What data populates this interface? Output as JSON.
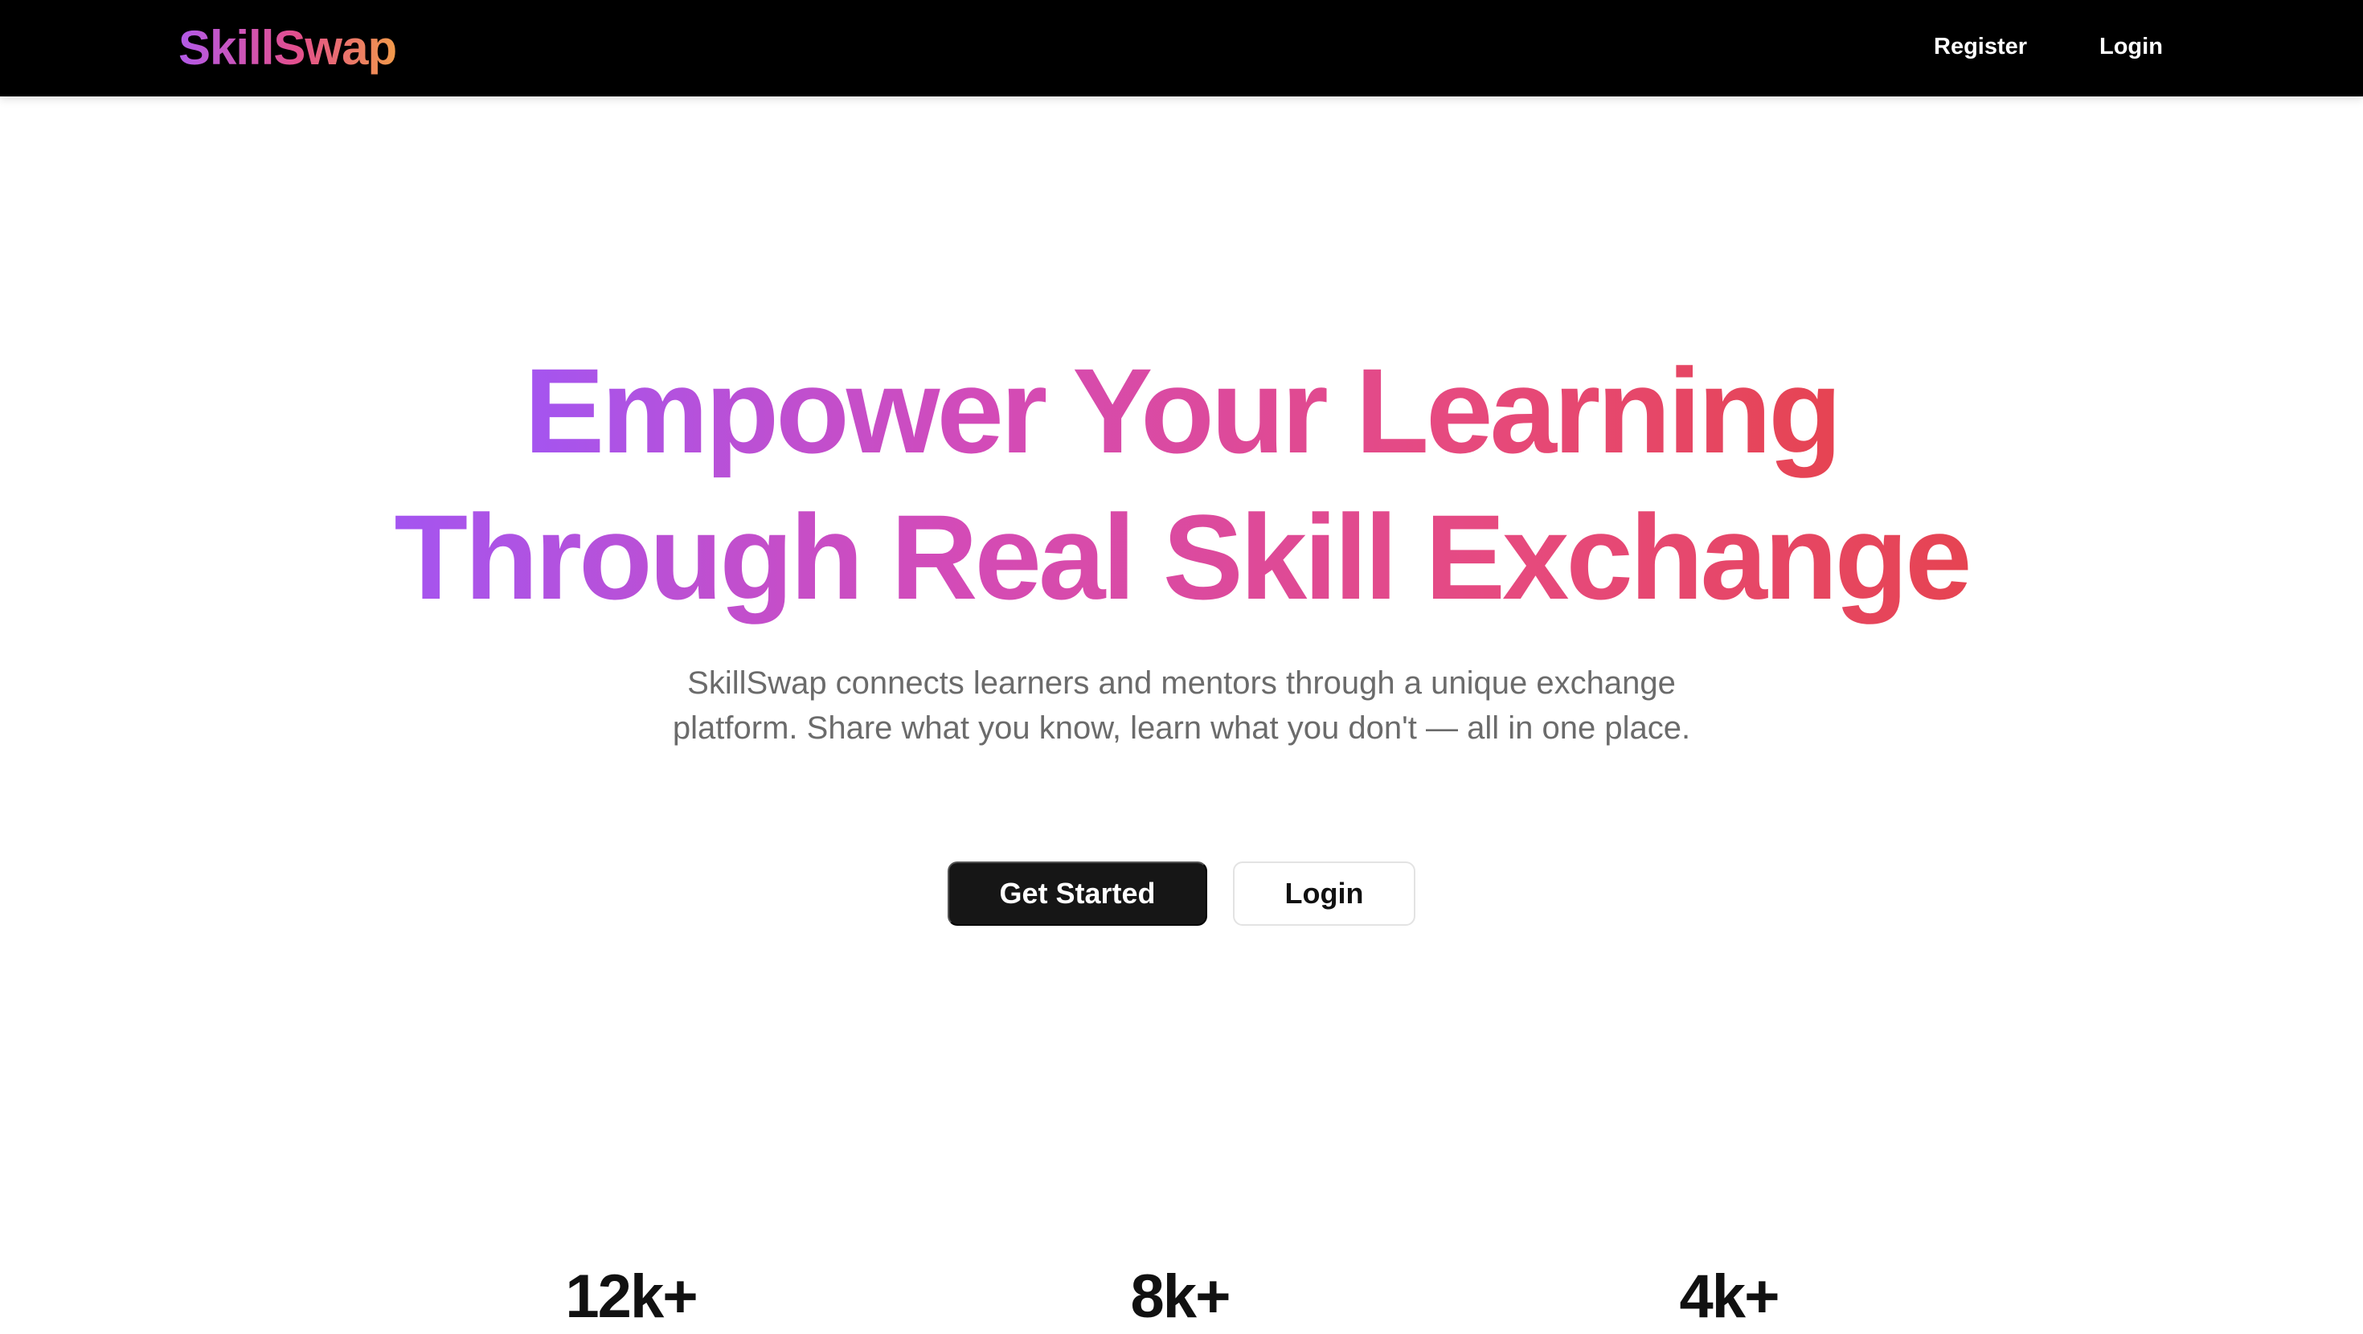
{
  "header": {
    "logo": "SkillSwap",
    "nav": {
      "register": "Register",
      "login": "Login"
    }
  },
  "hero": {
    "title_line1": "Empower Your Learning",
    "title_line2": "Through Real Skill Exchange",
    "subtitle": "SkillSwap connects learners and mentors through a unique exchange platform. Share what you know, learn what you don't — all in one place.",
    "primary_button": "Get Started",
    "secondary_button": "Login"
  },
  "stats": [
    {
      "value": "12k+"
    },
    {
      "value": "8k+"
    },
    {
      "value": "4k+"
    }
  ],
  "colors": {
    "navbar_bg": "#000000",
    "gradient_start": "#a455f0",
    "gradient_end": "#e64452",
    "primary_button_bg": "#161616"
  }
}
